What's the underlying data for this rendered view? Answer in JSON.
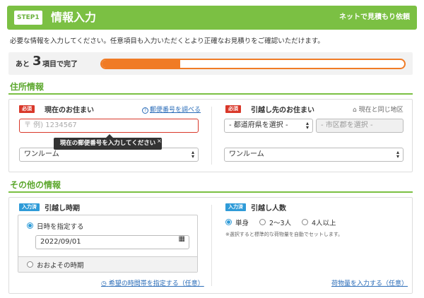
{
  "header": {
    "step_badge": "STEP1",
    "title": "情報入力",
    "right_text": "ネットで見積もり依頼",
    "color": "#7bc043"
  },
  "intro_text": "必要な情報を入力してください。任意項目も入力いただくとより正確なお見積りをご確認いただけます。",
  "progress": {
    "prefix": "あと",
    "number": "3",
    "suffix": "項目で完了",
    "fraction": 0.26,
    "color": "#f07b25"
  },
  "address_section": {
    "title": "住所情報",
    "current": {
      "badge": "必須",
      "label": "現在のお住まい",
      "postal_link": "郵便番号を調べる",
      "postal_placeholder": "〒 例) 1234567",
      "tooltip": "現在の郵便番号を入力してください",
      "tooltip_close": "×",
      "room_type": "ワンルーム"
    },
    "destination": {
      "badge": "必須",
      "label": "引越し先のお住まい",
      "same_area_link": "現在と同じ地区",
      "prefecture_select": "- 都道府県を選択 -",
      "city_select": "- 市区郡を選択 -",
      "room_type": "ワンルーム"
    }
  },
  "other_section": {
    "title": "その他の情報",
    "timing": {
      "badge": "入力済",
      "label": "引越し時期",
      "option_specify": "日時を指定する",
      "date_value": "2022/09/01",
      "option_rough": "おおよその時期",
      "time_link": "希望の時間帯を指定する（任意）"
    },
    "people": {
      "badge": "入力済",
      "label": "引越し人数",
      "options": [
        "単身",
        "2〜3人",
        "4人以上"
      ],
      "selected": 0,
      "note": "※選択すると標準的な荷物量を自動でセットします。",
      "luggage_link": "荷物量を入力する（任意）"
    }
  }
}
